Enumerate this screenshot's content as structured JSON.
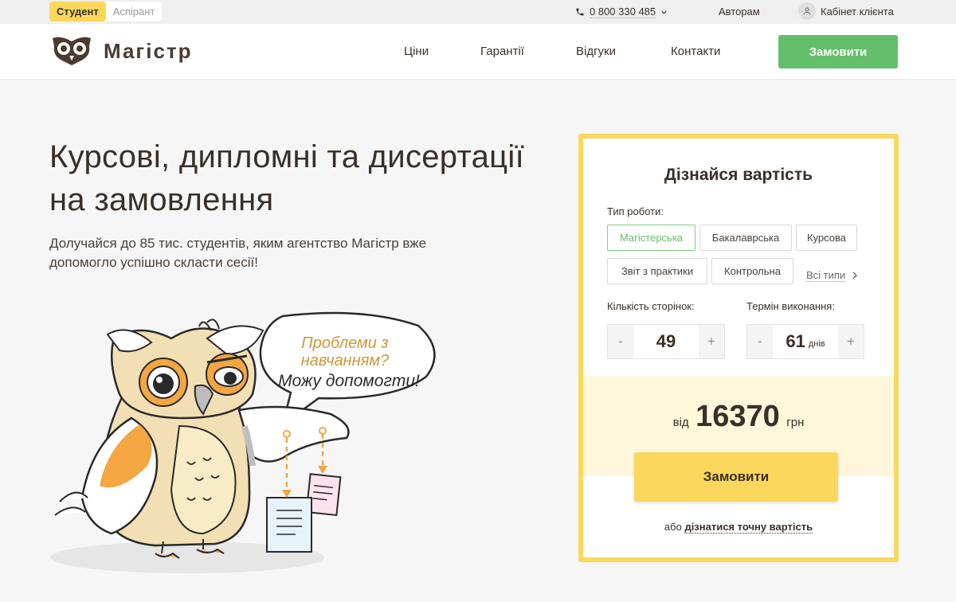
{
  "topbar": {
    "roles": [
      {
        "label": "Студент",
        "active": true
      },
      {
        "label": "Аспірант",
        "active": false
      }
    ],
    "phone": "0 800 330 485",
    "authors": "Авторам",
    "cabinet": "Кабінет клієнта"
  },
  "header": {
    "logo_text": "Магістр",
    "nav": [
      "Ціни",
      "Гарантії",
      "Відгуки",
      "Контакти"
    ],
    "order_button": "Замовити"
  },
  "hero": {
    "title": "Курсові, дипломні та дисертації на замовлення",
    "subtitle": "Долучайся до 85 тис. студентів, яким агентство Магістр вже допомогло успішно скласти сесії!",
    "speech_line1": "Проблеми з",
    "speech_line2": "навчанням?",
    "speech_line3": "Можу допомогти!"
  },
  "calculator": {
    "title": "Дізнайся вартість",
    "work_type_label": "Тип роботи:",
    "work_types": [
      {
        "label": "Магістерська",
        "active": true
      },
      {
        "label": "Бакалаврська",
        "active": false
      },
      {
        "label": "Курсова",
        "active": false
      },
      {
        "label": "Звіт з практики",
        "active": false
      },
      {
        "label": "Контрольна",
        "active": false
      }
    ],
    "all_types": "Всі типи",
    "pages_label": "Кількість сторінок:",
    "pages_value": "49",
    "deadline_label": "Термін виконання:",
    "deadline_value": "61",
    "deadline_unit": "днів",
    "minus": "-",
    "plus": "+",
    "price_prefix": "від",
    "price_value": "16370",
    "price_currency": "грн",
    "order_button": "Замовити",
    "footer_prefix": "або",
    "footer_link": "дізнатися точну вартість"
  },
  "colors": {
    "accent_yellow": "#fbd85b",
    "accent_green": "#64bf6a",
    "text_brown": "#3a2f28"
  }
}
